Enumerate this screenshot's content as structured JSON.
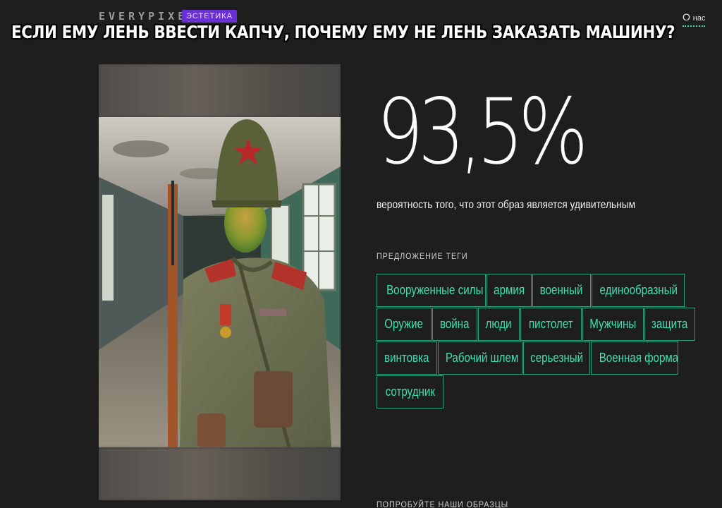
{
  "header": {
    "logo": "EVERYPIXEL",
    "badge": "ЭСТЕТИКА",
    "about_main": "О",
    "about_small": "нас"
  },
  "caption": "ЕСЛИ ЕМУ ЛЕНЬ ВВЕСТИ КАПЧУ, ПОЧЕМУ ЕМУ НЕ ЛЕНЬ ЗАКАЗАТЬ МАШИНУ?",
  "result": {
    "percent": "93,5%",
    "description": "вероятность того, что этот образ является удивительным"
  },
  "tags_section": {
    "title": "ПРЕДЛОЖЕНИЕ ТЕГИ",
    "rows": [
      [
        "Вооруженные силы",
        "армия",
        "военный",
        "единообразный"
      ],
      [
        "Оружие",
        "война",
        "люди",
        "пистолет",
        "Мужчины",
        "защита"
      ],
      [
        "винтовка",
        "Рабочий шлем",
        "серьезный",
        "Военная форма"
      ],
      [
        "сотрудник"
      ]
    ]
  },
  "footer": {
    "try_samples": "ПОПРОБУЙТЕ НАШИ ОБРАЗЦЫ"
  },
  "colors": {
    "background": "#1e1e1e",
    "accent": "#3fe0b0",
    "badge": "#6b2fd6"
  }
}
